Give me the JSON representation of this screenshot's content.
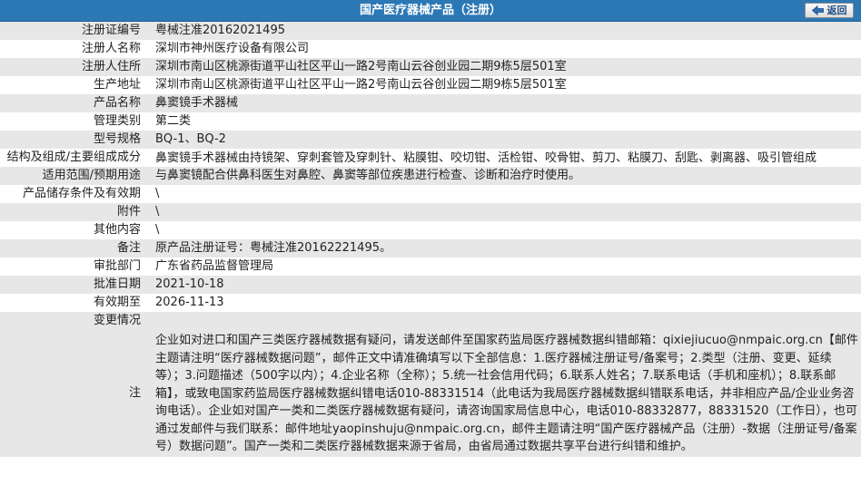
{
  "header": {
    "title": "国产医疗器械产品（注册）",
    "back_label": "返回",
    "back_icon": "back-arrow-icon"
  },
  "rows": [
    {
      "label": "注册证编号",
      "value": "粤械注准20162021495"
    },
    {
      "label": "注册人名称",
      "value": "深圳市神州医疗设备有限公司"
    },
    {
      "label": "注册人住所",
      "value": "深圳市南山区桃源街道平山社区平山一路2号南山云谷创业园二期9栋5层501室"
    },
    {
      "label": "生产地址",
      "value": "深圳市南山区桃源街道平山社区平山一路2号南山云谷创业园二期9栋5层501室"
    },
    {
      "label": "产品名称",
      "value": "鼻窦镜手术器械"
    },
    {
      "label": "管理类别",
      "value": "第二类"
    },
    {
      "label": "型号规格",
      "value": "BQ-1、BQ-2"
    },
    {
      "label": "结构及组成/主要组成成分",
      "value": "鼻窦镜手术器械由持镜架、穿刺套管及穿刺针、粘膜钳、咬切钳、活检钳、咬骨钳、剪刀、粘膜刀、刮匙、剥离器、吸引管组成"
    },
    {
      "label": "适用范围/预期用途",
      "value": "与鼻窦镜配合供鼻科医生对鼻腔、鼻窦等部位疾患进行检查、诊断和治疗时使用。"
    },
    {
      "label": "产品储存条件及有效期",
      "value": "\\"
    },
    {
      "label": "附件",
      "value": "\\"
    },
    {
      "label": "其他内容",
      "value": "\\"
    },
    {
      "label": "备注",
      "value": "原产品注册证号：粤械注准20162221495。"
    },
    {
      "label": "审批部门",
      "value": "广东省药品监督管理局"
    },
    {
      "label": "批准日期",
      "value": "2021-10-18"
    },
    {
      "label": "有效期至",
      "value": "2026-11-13"
    },
    {
      "label": "变更情况",
      "value": ""
    },
    {
      "label": "注",
      "value": "企业如对进口和国产三类医疗器械数据有疑问，请发送邮件至国家药监局医疗器械数据纠错邮箱：qixiejiucuo@nmpaic.org.cn【邮件主题请注明“医疗器械数据问题”，邮件正文中请准确填写以下全部信息：1.医疗器械注册证号/备案号；2.类型（注册、变更、延续等）；3.问题描述（500字以内）；4.企业名称（全称）；5.统一社会信用代码；6.联系人姓名；7.联系电话（手机和座机）；8.联系邮箱】，或致电国家药监局医疗器械数据纠错电话010-88331514（此电话为我局医疗器械数据纠错联系电话，并非相应产品/企业业务咨询电话）。企业如对国产一类和二类医疗器械数据有疑问，请咨询国家局信息中心，电话010-88332877，88331520（工作日），也可通过发邮件与我们联系：邮件地址yaopinshuju@nmpaic.org.cn，邮件主题请注明“国产医疗器械产品（注册）-数据（注册证号/备案号）数据问题”。国产一类和二类医疗器械数据来源于省局，由省局通过数据共享平台进行纠错和维护。"
    }
  ]
}
